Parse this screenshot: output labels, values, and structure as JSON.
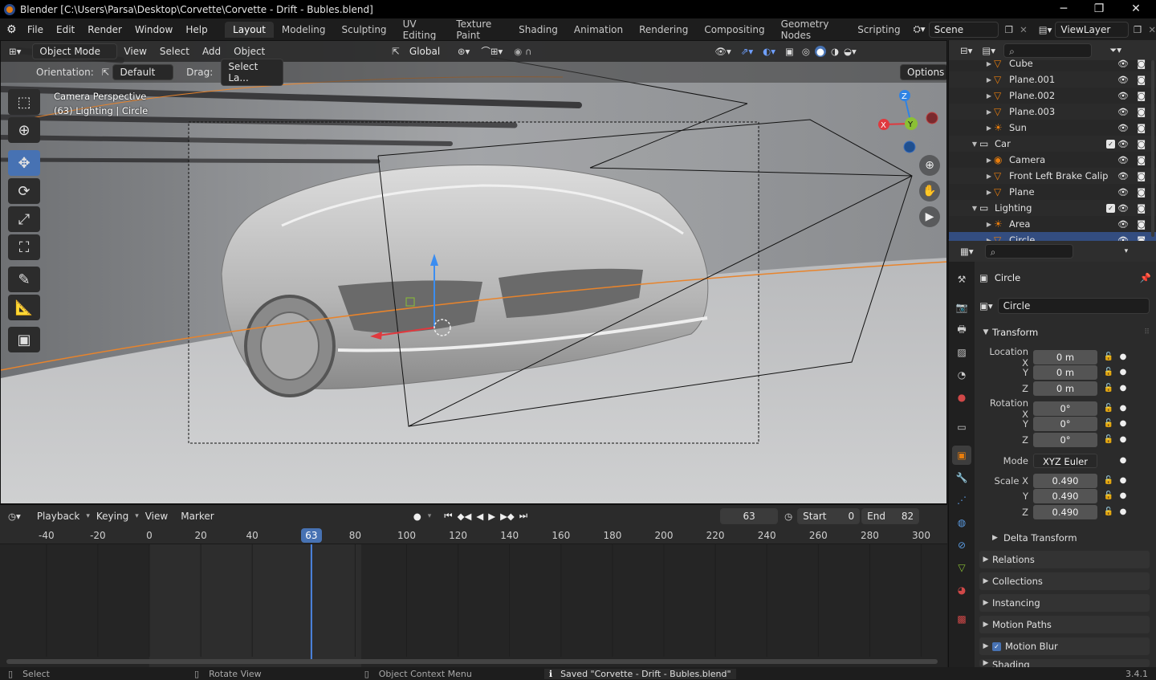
{
  "window": {
    "title": "Blender [C:\\Users\\Parsa\\Desktop\\Corvette\\Corvette - Drift - Bubles.blend]",
    "minimize": "─",
    "maximize": "❐",
    "close": "✕"
  },
  "menubar": {
    "menus": [
      "File",
      "Edit",
      "Render",
      "Window",
      "Help"
    ],
    "workspaces": [
      "Layout",
      "Modeling",
      "Sculpting",
      "UV Editing",
      "Texture Paint",
      "Shading",
      "Animation",
      "Rendering",
      "Compositing",
      "Geometry Nodes",
      "Scripting"
    ],
    "active_workspace": "Layout",
    "scene": "Scene",
    "view_layer": "ViewLayer"
  },
  "viewport": {
    "mode": "Object Mode",
    "menus": [
      "View",
      "Select",
      "Add",
      "Object"
    ],
    "transform_orientation": "Global",
    "orientation_label": "Orientation:",
    "orientation_value": "Default",
    "drag_label": "Drag:",
    "drag_value": "Select La...",
    "options": "Options",
    "overlay_title": "Camera Perspective",
    "overlay_subtitle": "(63) Lighting | Circle",
    "gizmo_z": "Z",
    "gizmo_y": "Y",
    "gizmo_x": "X"
  },
  "timeline": {
    "menus": [
      "Playback",
      "Keying",
      "View",
      "Marker"
    ],
    "current_frame": "63",
    "start_label": "Start",
    "start": "0",
    "end_label": "End",
    "end": "82",
    "ruler_ticks": [
      "-40",
      "-20",
      "0",
      "20",
      "40",
      "63",
      "80",
      "100",
      "120",
      "140",
      "160",
      "180",
      "200",
      "220",
      "240",
      "260",
      "280",
      "300"
    ],
    "ruler_frames": [
      -40,
      -20,
      0,
      20,
      40,
      63,
      80,
      100,
      120,
      140,
      160,
      180,
      200,
      220,
      240,
      260,
      280,
      300
    ]
  },
  "outliner": {
    "items": [
      {
        "name": "Cube",
        "type": "mesh",
        "indent": 2
      },
      {
        "name": "Plane.001",
        "type": "mesh",
        "indent": 2
      },
      {
        "name": "Plane.002",
        "type": "mesh",
        "indent": 2
      },
      {
        "name": "Plane.003",
        "type": "mesh",
        "indent": 2
      },
      {
        "name": "Sun",
        "type": "light",
        "indent": 2
      },
      {
        "name": "Car",
        "type": "collection",
        "indent": 1
      },
      {
        "name": "Camera",
        "type": "camera",
        "indent": 2
      },
      {
        "name": "Front Left Brake Calip",
        "type": "mesh",
        "indent": 2
      },
      {
        "name": "Plane",
        "type": "mesh",
        "indent": 2
      },
      {
        "name": "Lighting",
        "type": "collection",
        "indent": 1
      },
      {
        "name": "Area",
        "type": "light",
        "indent": 2
      },
      {
        "name": "Circle",
        "type": "mesh",
        "indent": 2
      }
    ]
  },
  "properties": {
    "object_name": "Circle",
    "datablock_name": "Circle",
    "transform_label": "Transform",
    "location_label": "Location X",
    "location": [
      "0 m",
      "0 m",
      "0 m"
    ],
    "rotation_label": "Rotation X",
    "rotation": [
      "0°",
      "0°",
      "0°"
    ],
    "mode_label": "Mode",
    "mode_value": "XYZ Euler",
    "scale_label": "Scale X",
    "scale": [
      "0.490",
      "0.490",
      "0.490"
    ],
    "axis_y": "Y",
    "axis_z": "Z",
    "delta_transform": "Delta Transform",
    "panels": [
      "Relations",
      "Collections",
      "Instancing",
      "Motion Paths",
      "Motion Blur",
      "Shading"
    ]
  },
  "statusbar": {
    "select": "Select",
    "rotate": "Rotate View",
    "context": "Object Context Menu",
    "message": "Saved \"Corvette - Drift - Bubles.blend\"",
    "version": "3.4.1"
  },
  "colors": {
    "accent": "#4772b3",
    "x_axis": "#e0393e",
    "y_axis": "#8bc034",
    "z_axis": "#2f83e4",
    "mesh_icon": "#e87d0d",
    "highlight_row": "#334d80"
  }
}
